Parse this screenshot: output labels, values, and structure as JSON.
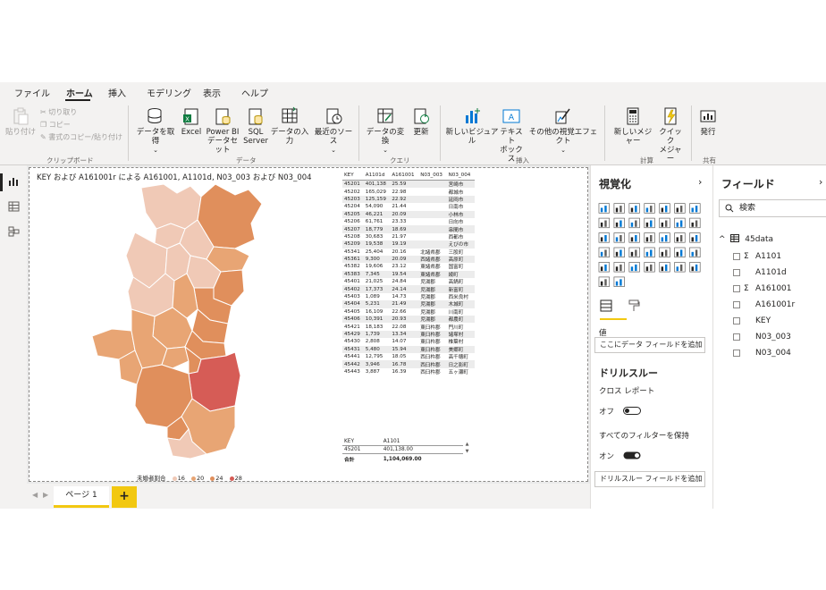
{
  "menu": {
    "tabs": [
      "ファイル",
      "ホーム",
      "挿入",
      "モデリング",
      "表示",
      "ヘルプ"
    ],
    "active_tab": "ホーム"
  },
  "ribbon": {
    "clipboard": {
      "paste": "貼り付け",
      "cut": "切り取り",
      "copy": "コピー",
      "format_painter": "書式のコピー/貼り付け",
      "group_label": "クリップボード"
    },
    "data": {
      "get_data": "データを取得",
      "excel": "Excel",
      "powerbi_1": "Power BI",
      "powerbi_2": "データセット",
      "sql_1": "SQL",
      "sql_2": "Server",
      "enter_data": "データの入力",
      "recent": "最近のソース",
      "group_label": "データ"
    },
    "query": {
      "transform": "データの変換",
      "refresh": "更新",
      "group_label": "クエリ"
    },
    "insert": {
      "new_visual": "新しいビジュアル",
      "textbox_1": "テキスト",
      "textbox_2": "ボックス",
      "more_visuals": "その他の視覚エフェクト",
      "group_label": "挿入"
    },
    "calc": {
      "new_measure": "新しいメジャー",
      "quick_1": "クイック",
      "quick_2": "メジャー",
      "group_label": "計算"
    },
    "share": {
      "publish": "発行",
      "group_label": "共有"
    }
  },
  "canvas": {
    "map_title": "KEY および A161001r による A161001, A1101d, N03_003 および N03_004",
    "legend": {
      "title": "未婚者割合",
      "items": [
        "16",
        "20",
        "24",
        "28"
      ],
      "colors": [
        "#f0c9b6",
        "#e8a574",
        "#e08f5c",
        "#d65c56"
      ]
    },
    "table": {
      "headers": [
        "KEY",
        "A1101d",
        "A161001",
        "N03_003",
        "N03_004"
      ],
      "rows": [
        [
          "45201",
          "401,138",
          "25.59",
          "",
          "宮崎市"
        ],
        [
          "45202",
          "165,029",
          "22.98",
          "",
          "都城市"
        ],
        [
          "45203",
          "125,159",
          "22.92",
          "",
          "延岡市"
        ],
        [
          "45204",
          "54,090",
          "21.44",
          "",
          "日南市"
        ],
        [
          "45205",
          "46,221",
          "20.09",
          "",
          "小林市"
        ],
        [
          "45206",
          "61,761",
          "23.33",
          "",
          "日向市"
        ],
        [
          "45207",
          "18,779",
          "18.69",
          "",
          "串間市"
        ],
        [
          "45208",
          "30,683",
          "21.97",
          "",
          "西都市"
        ],
        [
          "45209",
          "19,538",
          "19.19",
          "",
          "えびの市"
        ],
        [
          "45341",
          "25,404",
          "20.16",
          "北諸県郡",
          "三股町"
        ],
        [
          "45361",
          "9,300",
          "20.09",
          "西諸県郡",
          "高原町"
        ],
        [
          "45382",
          "19,606",
          "23.12",
          "東諸県郡",
          "国富町"
        ],
        [
          "45383",
          "7,345",
          "19.54",
          "東諸県郡",
          "綾町"
        ],
        [
          "45401",
          "21,025",
          "24.84",
          "児湯郡",
          "高鍋町"
        ],
        [
          "45402",
          "17,373",
          "24.14",
          "児湯郡",
          "新富町"
        ],
        [
          "45403",
          "1,089",
          "14.73",
          "児湯郡",
          "西米良村"
        ],
        [
          "45404",
          "5,231",
          "21.49",
          "児湯郡",
          "木城町"
        ],
        [
          "45405",
          "16,109",
          "22.66",
          "児湯郡",
          "川南町"
        ],
        [
          "45406",
          "10,391",
          "20.93",
          "児湯郡",
          "都農町"
        ],
        [
          "45421",
          "18,183",
          "22.08",
          "東臼杵郡",
          "門川町"
        ],
        [
          "45429",
          "1,739",
          "13.34",
          "東臼杵郡",
          "諸塚村"
        ],
        [
          "45430",
          "2,808",
          "14.07",
          "東臼杵郡",
          "椎葉村"
        ],
        [
          "45431",
          "5,480",
          "15.94",
          "東臼杵郡",
          "美郷町"
        ],
        [
          "45441",
          "12,795",
          "18.05",
          "西臼杵郡",
          "高千穂町"
        ],
        [
          "45442",
          "3,946",
          "16.78",
          "西臼杵郡",
          "日之影町"
        ],
        [
          "45443",
          "3,887",
          "16.39",
          "西臼杵郡",
          "五ヶ瀬町"
        ]
      ]
    },
    "table2": {
      "headers": [
        "KEY",
        "A1101"
      ],
      "row": [
        "45201",
        "401,138.00"
      ],
      "total": [
        "合計",
        "1,104,069.00"
      ]
    }
  },
  "pages": {
    "tab": "ページ 1",
    "add": "+"
  },
  "viz_pane": {
    "title": "視覚化",
    "values_label": "値",
    "values_placeholder": "ここにデータ フィールドを追加",
    "drill_title": "ドリルスルー",
    "cross_report": "クロス レポート",
    "off_label": "オフ",
    "keep_filters": "すべてのフィルターを保持",
    "on_label": "オン",
    "drill_placeholder": "ドリルスルー フィールドを追加"
  },
  "fields_pane": {
    "title": "フィールド",
    "search_placeholder": "検索",
    "table_name": "45data",
    "fields": [
      {
        "name": "A1101",
        "sigma": "Σ"
      },
      {
        "name": "A1101d",
        "sigma": ""
      },
      {
        "name": "A161001",
        "sigma": "Σ"
      },
      {
        "name": "A161001r",
        "sigma": ""
      },
      {
        "name": "KEY",
        "sigma": ""
      },
      {
        "name": "N03_003",
        "sigma": ""
      },
      {
        "name": "N03_004",
        "sigma": ""
      }
    ]
  }
}
